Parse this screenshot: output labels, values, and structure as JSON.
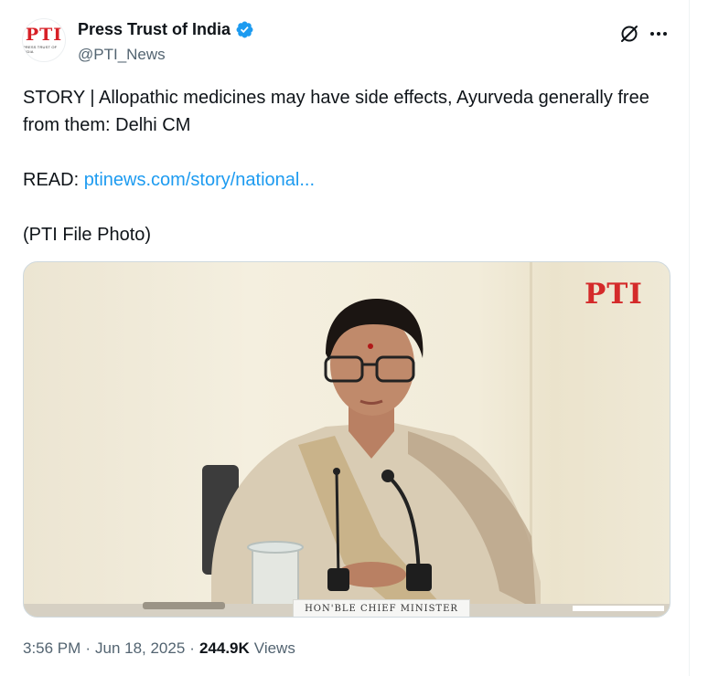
{
  "author": {
    "display_name": "Press Trust of India",
    "handle": "@PTI_News",
    "avatar_logo_text": "PTI",
    "avatar_logo_subtext": "PRESS TRUST OF INDIA",
    "verified_icon": "verified-badge-icon"
  },
  "tweet": {
    "line1": "STORY | Allopathic medicines may have side effects, Ayurveda generally free from them: Delhi CM",
    "read_label": "READ: ",
    "link_text": "ptinews.com/story/national...",
    "credit": "(PTI File Photo)"
  },
  "media": {
    "watermark": "PTI",
    "nameplate": "HON'BLE CHIEF MINISTER"
  },
  "meta": {
    "time": "3:56 PM",
    "date": "Jun 18, 2025",
    "separator": "·",
    "views_count": "244.9K",
    "views_label": "Views"
  },
  "actions": {
    "grok_icon": "grok-icon",
    "more_icon": "more-options-icon"
  },
  "colors": {
    "link": "#1d9bf0",
    "verified": "#1d9bf0",
    "secondary_text": "#536471",
    "brand_red": "#d71f26"
  }
}
